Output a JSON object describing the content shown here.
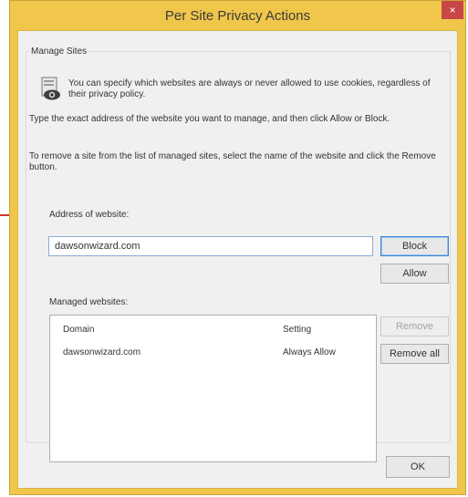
{
  "window": {
    "title": "Per Site Privacy Actions",
    "close_glyph": "×"
  },
  "manage_sites": {
    "group_label": "Manage Sites",
    "icon": "privacy-shield-icon",
    "info_text": "You can specify which websites are always or never allowed to use cookies, regardless of their privacy policy.",
    "type_instructions": "Type the exact address of the website you want to manage, and then click Allow or Block.",
    "remove_instructions": "To remove a site from the list of managed sites, select the name of the website and click the Remove button."
  },
  "address": {
    "label": "Address of website:",
    "value": "dawsonwizard.com"
  },
  "buttons": {
    "block": "Block",
    "allow": "Allow",
    "remove": "Remove",
    "remove_all": "Remove all",
    "ok": "OK"
  },
  "managed": {
    "label": "Managed websites:",
    "columns": [
      "Domain",
      "Setting"
    ],
    "rows": [
      {
        "domain": "dawsonwizard.com",
        "setting": "Always Allow"
      }
    ]
  },
  "colors": {
    "title_bar": "#f0c64b",
    "close_button": "#c74747",
    "annotation_arrow": "#d23b2a"
  }
}
